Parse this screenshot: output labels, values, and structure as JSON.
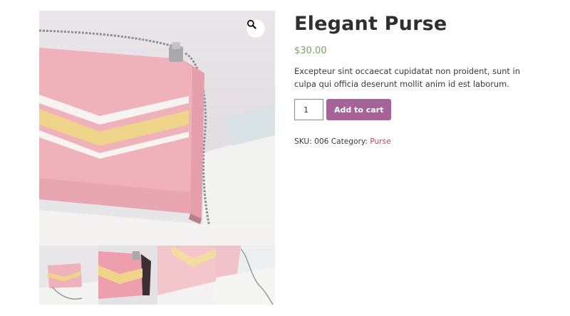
{
  "product": {
    "title": "Elegant Purse",
    "price": "$30.00",
    "description": "Excepteur sint occaecat cupidatat non proident, sunt in culpa qui officia deserunt mollit anim id est laborum.",
    "quantity": "1",
    "add_to_cart_label": "Add to cart",
    "sku_label": "SKU:",
    "sku_value": "006",
    "category_label": "Category:",
    "category_value": "Purse"
  },
  "gallery": {
    "zoom_icon": "magnifier-icon",
    "thumbnail_count": 4
  },
  "colors": {
    "price": "#77a464",
    "button": "#a46497",
    "category_link": "#b0476d",
    "purse_pink": "#f0b4bd"
  }
}
